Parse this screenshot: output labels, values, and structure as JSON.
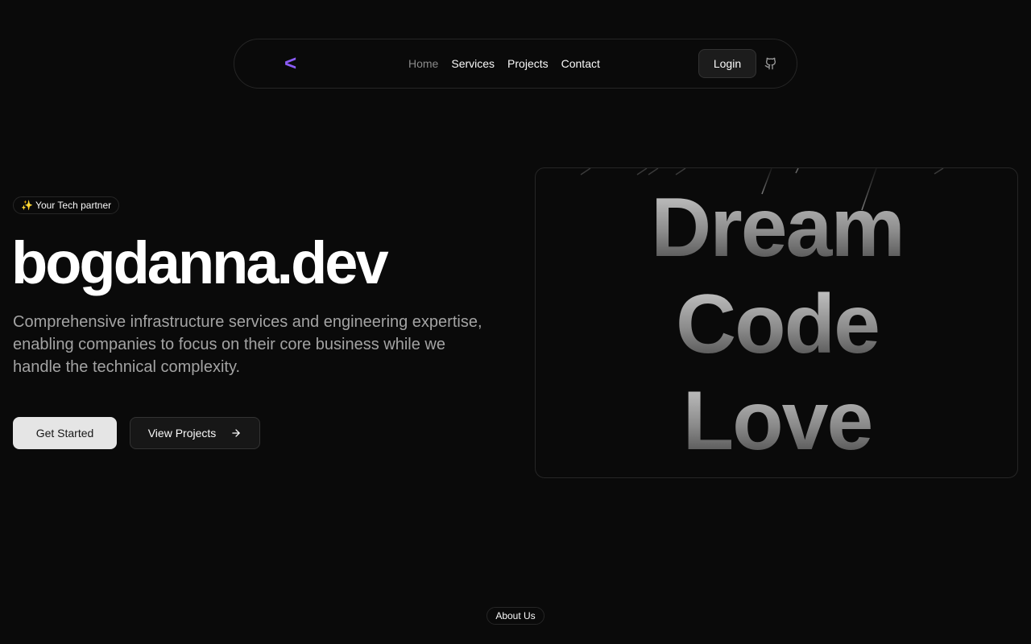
{
  "nav": {
    "logo": "<",
    "links": [
      {
        "label": "Home",
        "active": true
      },
      {
        "label": "Services"
      },
      {
        "label": "Projects"
      },
      {
        "label": "Contact"
      }
    ],
    "login_label": "Login",
    "github_icon": "github-icon"
  },
  "hero": {
    "badge": "✨ Your Tech partner",
    "title": "bogdanna.dev",
    "description": "Comprehensive infrastructure services and engineering expertise, enabling companies to focus on their core business while we handle the technical complexity.",
    "primary_button": "Get Started",
    "secondary_button": "View Projects",
    "secondary_icon": "arrow-right-icon",
    "words": [
      "Dream",
      "Code",
      "Love"
    ]
  },
  "about": {
    "badge": "About Us"
  },
  "colors": {
    "background": "#0a0a0a",
    "accent": "#8b5cf6",
    "border": "#262626"
  }
}
